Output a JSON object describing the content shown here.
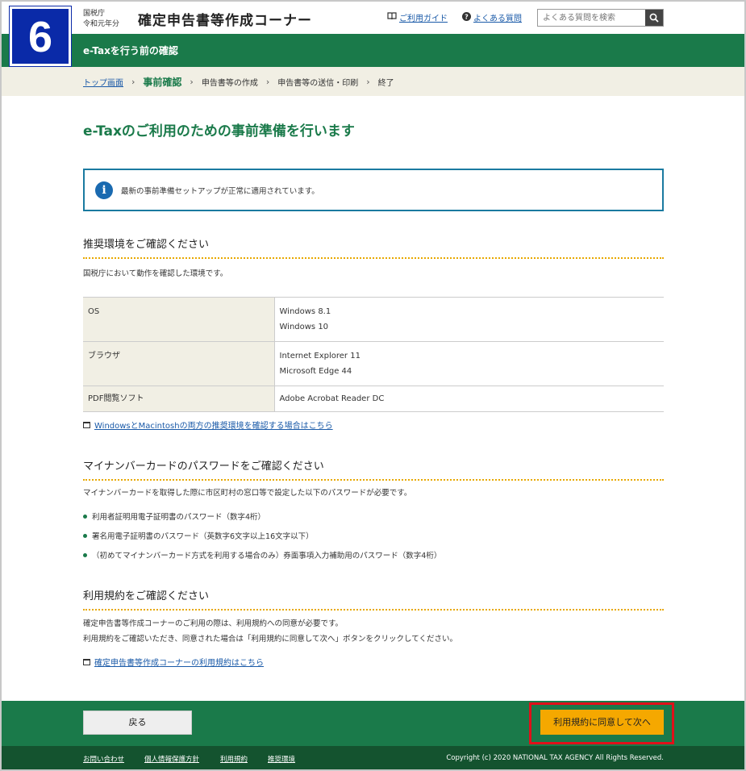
{
  "step_number": "6",
  "header": {
    "agency_line1": "国税庁",
    "agency_line2": "令和元年分",
    "app_title": "確定申告書等作成コーナー",
    "guide_link": "ご利用ガイド",
    "faq_link": "よくある質問",
    "search_placeholder": "よくある質問を検索"
  },
  "green_bar_title": "e-Taxを行う前の確認",
  "breadcrumb": {
    "top": "トップ画面",
    "current": "事前確認",
    "step3": "申告書等の作成",
    "step4": "申告書等の送信・印刷",
    "step5": "終了"
  },
  "page_title": "e-Taxのご利用のための事前準備を行います",
  "info_message": "最新の事前準備セットアップが正常に適用されています。",
  "env_section": {
    "heading": "推奨環境をご確認ください",
    "intro": "国税庁において動作を確認した環境です。",
    "rows": [
      {
        "key": "OS",
        "values": [
          "Windows 8.1",
          "Windows 10"
        ]
      },
      {
        "key": "ブラウザ",
        "values": [
          "Internet Explorer 11",
          "Microsoft Edge 44"
        ]
      },
      {
        "key": "PDF閲覧ソフト",
        "values": [
          "Adobe Acrobat Reader DC"
        ]
      }
    ],
    "link": "WindowsとMacintoshの両方の推奨環境を確認する場合はこちら"
  },
  "pwd_section": {
    "heading": "マイナンバーカードのパスワードをご確認ください",
    "intro": "マイナンバーカードを取得した際に市区町村の窓口等で設定した以下のパスワードが必要です。",
    "items": [
      "利用者証明用電子証明書のパスワード（数字4桁）",
      "署名用電子証明書のパスワード（英数字6文字以上16文字以下）",
      "（初めてマイナンバーカード方式を利用する場合のみ）券面事項入力補助用のパスワード（数字4桁）"
    ]
  },
  "terms_section": {
    "heading": "利用規約をご確認ください",
    "line1": "確定申告書等作成コーナーのご利用の際は、利用規約への同意が必要です。",
    "line2": "利用規約をご確認いただき、同意された場合は「利用規約に同意して次へ」ボタンをクリックしてください。",
    "link": "確定申告書等作成コーナーの利用規約はこちら"
  },
  "buttons": {
    "back": "戻る",
    "agree": "利用規約に同意して次へ"
  },
  "footer": {
    "contact": "お問い合わせ",
    "privacy": "個人情報保護方針",
    "terms": "利用規約",
    "env": "推奨環境",
    "copyright": "Copyright (c) 2020 NATIONAL TAX AGENCY All Rights Reserved."
  }
}
